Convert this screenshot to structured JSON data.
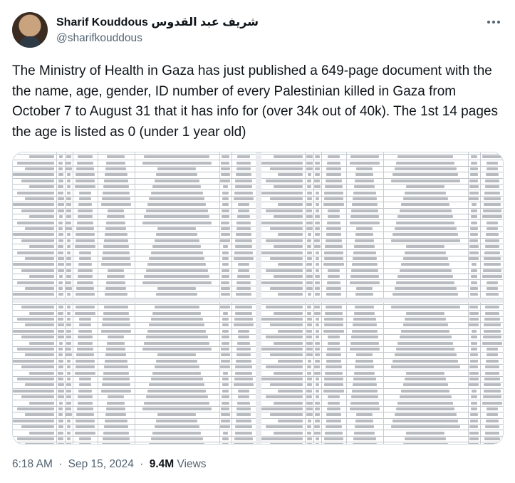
{
  "author": {
    "display_name": "Sharif Kouddous شريف عبد القدوس",
    "handle": "@sharifkouddous",
    "avatar_icon": "profile-photo"
  },
  "tweet": {
    "text": "The Ministry of Health in Gaza has just published a 649-page document with the the name, age, gender, ID number of every Palestinian killed in Gaza from October 7 to August 31 that it has info for (over 34k out of 40k). The 1st 14 pages the age is listed as 0 (under 1 year old)"
  },
  "media": {
    "kind": "document-scan",
    "panels": [
      "top-left",
      "top-right",
      "bottom-left",
      "bottom-right"
    ]
  },
  "meta": {
    "time": "6:18 AM",
    "date": "Sep 15, 2024",
    "separator": "·",
    "views_count": "9.4M",
    "views_label": "Views"
  },
  "icons": {
    "more": "more-horizontal-icon"
  },
  "colors": {
    "text": "#0f1419",
    "secondary": "#536471",
    "border": "#cfd9de"
  }
}
